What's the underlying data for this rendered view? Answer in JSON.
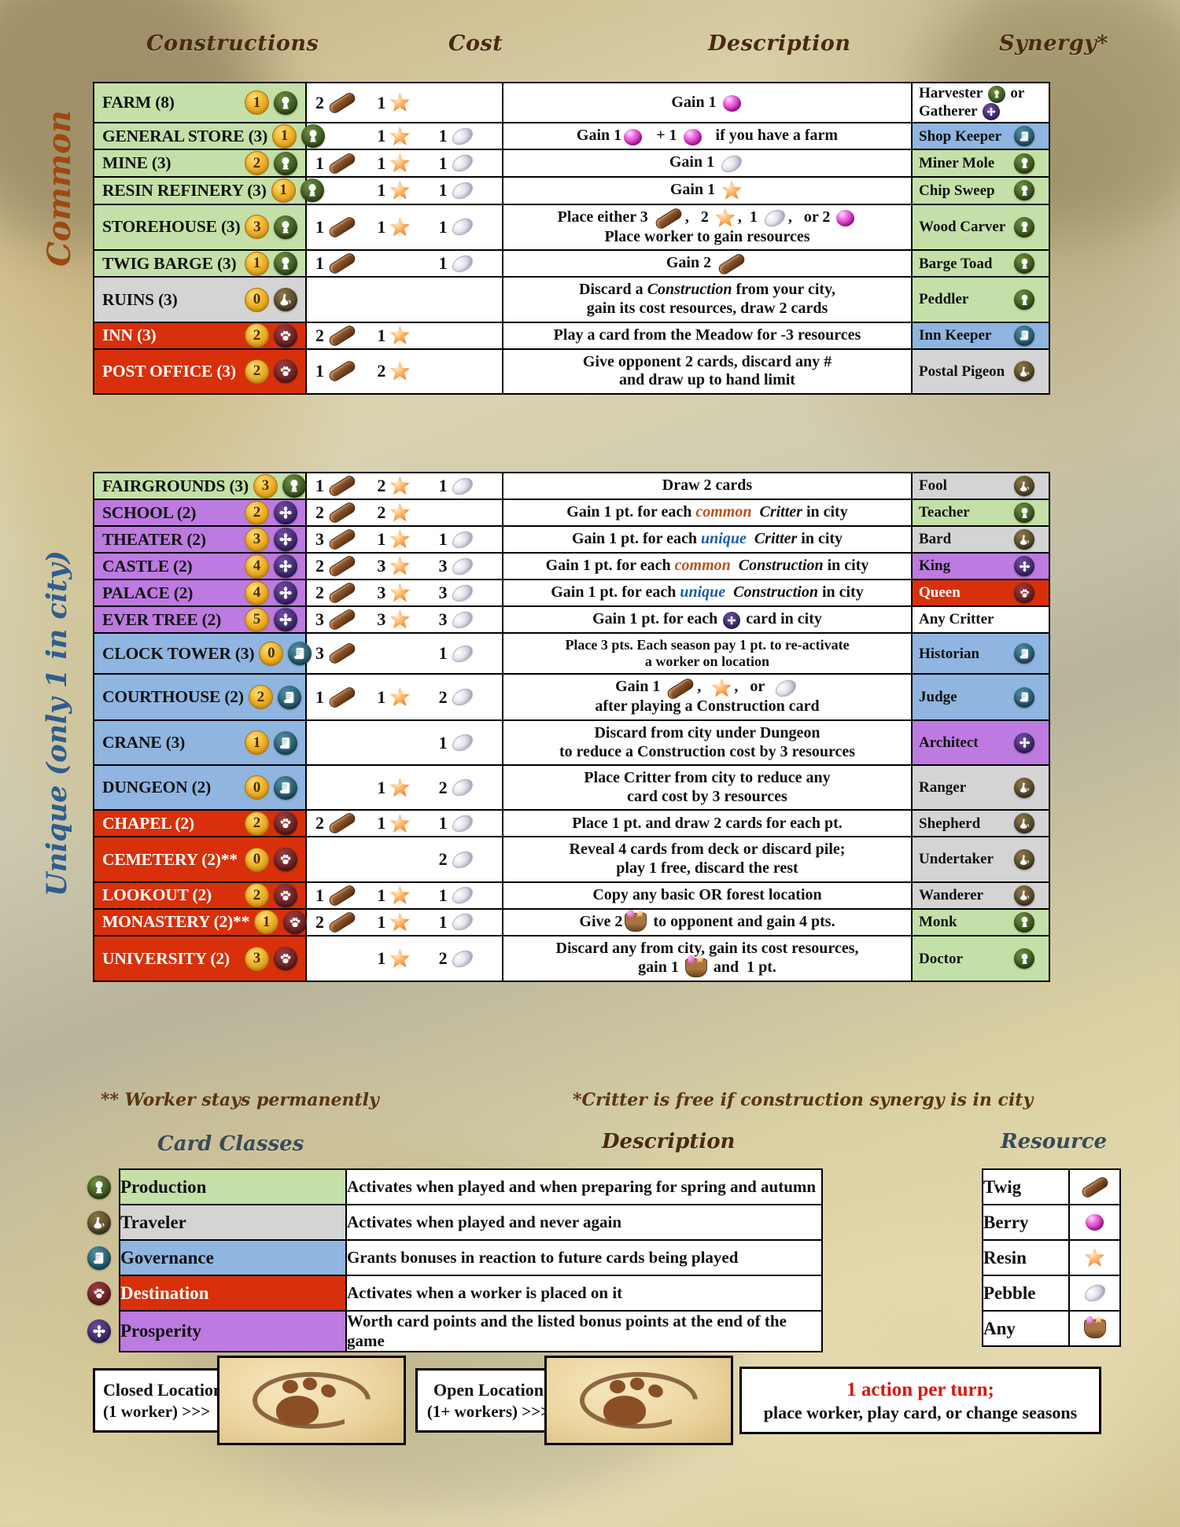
{
  "headers": {
    "constructions": "Constructions",
    "cost": "Cost",
    "description": "Description",
    "synergy": "Synergy*"
  },
  "side_labels": {
    "common": "Common",
    "unique": "Unique (only 1 in city)"
  },
  "footnotes": {
    "worker": "** Worker stays permanently",
    "critter": "*Critter is free if construction synergy is in city"
  },
  "common_rows": [
    {
      "name": "FARM (8)",
      "points": "1",
      "class": "production",
      "row_color": "green",
      "cost": [
        {
          "n": "2",
          "res": "twig"
        },
        {
          "n": "1",
          "res": "resin"
        },
        {
          "n": "",
          "res": ""
        }
      ],
      "desc_html": "Gain 1 <span class='inline-res'><span class='res res-berry'></span></span>",
      "synergy": "Harvester <span class='syn-inline-badge b-production'><svg viewBox='0 0 24 24'><path d='M12 3c-3 0-5 2.2-5 5 0 2.6 1.8 4.2 3.4 5.1-.9.6-1.6 1.4-1.6 2.4 0 1 .6 1.6 1.4 2.2H8v2h8v-2h-2.2c.8-.6 1.4-1.2 1.4-2.2 0-1-.7-1.8-1.6-2.4C15.2 12.2 17 10.6 17 8c0-2.8-2-5-5-5z' fill='#ffffff'/></svg></span> or<br>Gatherer <span class='syn-inline-badge b-prosperity'><svg viewBox='0 0 24 24'><g fill='#ffffff'><circle cx='12' cy='12' r='2.6'/><ellipse cx='12' cy='6.3' rx='2.6' ry='3.4'/><ellipse cx='12' cy='17.7' rx='2.6' ry='3.4'/><ellipse cx='6.3' cy='12' rx='3.4' ry='2.6'/><ellipse cx='17.7' cy='12' rx='3.4' ry='2.6'/></g></svg></span>",
      "syn_color": "white",
      "syn_badge": "none",
      "syn_light": false
    },
    {
      "name": "GENERAL STORE (3)",
      "points": "1",
      "class": "production",
      "row_color": "green",
      "cost": [
        {
          "n": "",
          "res": ""
        },
        {
          "n": "1",
          "res": "resin"
        },
        {
          "n": "1",
          "res": "pebble"
        }
      ],
      "desc_html": "Gain 1<span class='inline-res'><span class='res res-berry'></span></span> &nbsp;&nbsp;+ 1 <span class='inline-res'><span class='res res-berry'></span></span> &nbsp;&nbsp;if you have a farm",
      "synergy": "Shop Keeper",
      "syn_color": "blue",
      "syn_badge": "governance",
      "syn_light": false
    },
    {
      "name": "MINE (3)",
      "points": "2",
      "class": "production",
      "row_color": "green",
      "cost": [
        {
          "n": "1",
          "res": "twig"
        },
        {
          "n": "1",
          "res": "resin"
        },
        {
          "n": "1",
          "res": "pebble"
        }
      ],
      "desc_html": "Gain 1 <span class='inline-res'><span class='res res-pebble'></span></span>",
      "synergy": "Miner Mole",
      "syn_color": "green",
      "syn_badge": "production",
      "syn_light": false
    },
    {
      "name": "RESIN REFINERY (3)",
      "points": "1",
      "class": "production",
      "row_color": "green",
      "cost": [
        {
          "n": "",
          "res": ""
        },
        {
          "n": "1",
          "res": "resin"
        },
        {
          "n": "1",
          "res": "pebble"
        }
      ],
      "desc_html": "Gain 1 <span class='inline-res'><span class='res res-resin'></span></span>",
      "synergy": "Chip Sweep",
      "syn_color": "green",
      "syn_badge": "production",
      "syn_light": false
    },
    {
      "name": "STOREHOUSE (3)",
      "points": "3",
      "class": "production",
      "row_color": "green",
      "cost": [
        {
          "n": "1",
          "res": "twig"
        },
        {
          "n": "1",
          "res": "resin"
        },
        {
          "n": "1",
          "res": "pebble"
        }
      ],
      "desc_html": "Place either 3 <span class='inline-res'><span class='res res-twig'></span></span>, &nbsp; 2 <span class='inline-res'><span class='res res-resin'></span></span>, &nbsp;1 <span class='inline-res'><span class='res res-pebble'></span></span>, &nbsp; or 2 <span class='inline-res'><span class='res res-berry'></span></span><br>Place worker to gain resources",
      "synergy": "Wood Carver",
      "syn_color": "green",
      "syn_badge": "production",
      "syn_light": false
    },
    {
      "name": "TWIG BARGE (3)",
      "points": "1",
      "class": "production",
      "row_color": "green",
      "cost": [
        {
          "n": "1",
          "res": "twig"
        },
        {
          "n": "",
          "res": ""
        },
        {
          "n": "1",
          "res": "pebble"
        }
      ],
      "desc_html": "Gain 2 <span class='inline-res'><span class='res res-twig'></span></span>",
      "synergy": "Barge Toad",
      "syn_color": "green",
      "syn_badge": "production",
      "syn_light": false
    },
    {
      "name": "RUINS (3)",
      "points": "0",
      "class": "traveler",
      "row_color": "gray",
      "cost": [
        {
          "n": "",
          "res": ""
        },
        {
          "n": "",
          "res": ""
        },
        {
          "n": "",
          "res": ""
        }
      ],
      "desc_html": "Discard a <span class='em'>Construction</span> from your city,<br>gain its cost resources, draw 2 cards",
      "synergy": "Peddler",
      "syn_color": "green",
      "syn_badge": "production",
      "syn_light": false
    },
    {
      "name": "INN (3)",
      "points": "2",
      "class": "destination",
      "row_color": "red",
      "cost": [
        {
          "n": "2",
          "res": "twig"
        },
        {
          "n": "1",
          "res": "resin"
        },
        {
          "n": "",
          "res": ""
        }
      ],
      "desc_html": "Play a card from the Meadow for -3 resources",
      "synergy": "Inn Keeper",
      "syn_color": "blue",
      "syn_badge": "governance",
      "syn_light": false,
      "name_light": true
    },
    {
      "name": "POST OFFICE (3)",
      "points": "2",
      "class": "destination",
      "row_color": "red",
      "cost": [
        {
          "n": "1",
          "res": "twig"
        },
        {
          "n": "2",
          "res": "resin"
        },
        {
          "n": "",
          "res": ""
        }
      ],
      "desc_html": "Give opponent 2 cards, discard any #<br>and draw up to hand limit",
      "synergy": "Postal Pigeon",
      "syn_color": "gray",
      "syn_badge": "traveler",
      "syn_light": false,
      "name_light": true
    }
  ],
  "unique_rows": [
    {
      "name": "FAIRGROUNDS (3)",
      "points": "3",
      "class": "production",
      "row_color": "green",
      "cost": [
        {
          "n": "1",
          "res": "twig"
        },
        {
          "n": "2",
          "res": "resin"
        },
        {
          "n": "1",
          "res": "pebble"
        }
      ],
      "desc_html": "Draw 2 cards",
      "synergy": "Fool",
      "syn_color": "gray",
      "syn_badge": "traveler",
      "syn_light": false
    },
    {
      "name": "SCHOOL (2)",
      "points": "2",
      "class": "prosperity",
      "row_color": "purple",
      "cost": [
        {
          "n": "2",
          "res": "twig"
        },
        {
          "n": "2",
          "res": "resin"
        },
        {
          "n": "",
          "res": ""
        }
      ],
      "desc_html": "Gain 1 pt. for each <span class='common-w'>common</span> &nbsp;<span class='em'>Critter</span> in city",
      "synergy": "Teacher",
      "syn_color": "green",
      "syn_badge": "production",
      "syn_light": false
    },
    {
      "name": "THEATER (2)",
      "points": "3",
      "class": "prosperity",
      "row_color": "purple",
      "cost": [
        {
          "n": "3",
          "res": "twig"
        },
        {
          "n": "1",
          "res": "resin"
        },
        {
          "n": "1",
          "res": "pebble"
        }
      ],
      "desc_html": "Gain 1 pt. for each <span class='unique-w'>unique</span> &nbsp;<span class='em'>Critter</span> in city",
      "synergy": "Bard",
      "syn_color": "gray",
      "syn_badge": "traveler",
      "syn_light": false
    },
    {
      "name": "CASTLE (2)",
      "points": "4",
      "class": "prosperity",
      "row_color": "purple",
      "cost": [
        {
          "n": "2",
          "res": "twig"
        },
        {
          "n": "3",
          "res": "resin"
        },
        {
          "n": "3",
          "res": "pebble"
        }
      ],
      "desc_html": "Gain 1 pt. for each <span class='common-w'>common</span> &nbsp;<span class='em'>Construction</span> in city",
      "synergy": "King",
      "syn_color": "purple",
      "syn_badge": "prosperity",
      "syn_light": false
    },
    {
      "name": "PALACE (2)",
      "points": "4",
      "class": "prosperity",
      "row_color": "purple",
      "cost": [
        {
          "n": "2",
          "res": "twig"
        },
        {
          "n": "3",
          "res": "resin"
        },
        {
          "n": "3",
          "res": "pebble"
        }
      ],
      "desc_html": "Gain 1 pt. for each <span class='unique-w'>unique</span> &nbsp;<span class='em'>Construction</span> in city",
      "synergy": "Queen",
      "syn_color": "red",
      "syn_badge": "destination",
      "syn_light": true
    },
    {
      "name": "EVER TREE (2)",
      "points": "5",
      "class": "prosperity",
      "row_color": "purple",
      "cost": [
        {
          "n": "3",
          "res": "twig"
        },
        {
          "n": "3",
          "res": "resin"
        },
        {
          "n": "3",
          "res": "pebble"
        }
      ],
      "desc_html": "Gain 1 pt. for each <span class='syn-inline-badge b-prosperity'><svg viewBox='0 0 24 24'><g fill='#ffffff'><circle cx='12' cy='12' r='2.6'/><ellipse cx='12' cy='6.3' rx='2.6' ry='3.4'/><ellipse cx='12' cy='17.7' rx='2.6' ry='3.4'/><ellipse cx='6.3' cy='12' rx='3.4' ry='2.6'/><ellipse cx='17.7' cy='12' rx='3.4' ry='2.6'/></g></svg></span> card in city",
      "synergy": "Any Critter",
      "syn_color": "white",
      "syn_badge": "none",
      "syn_light": false
    },
    {
      "name": "CLOCK TOWER (3)",
      "points": "0",
      "class": "governance",
      "row_color": "blue",
      "cost": [
        {
          "n": "3",
          "res": "twig"
        },
        {
          "n": "",
          "res": ""
        },
        {
          "n": "1",
          "res": "pebble"
        }
      ],
      "desc_html": "Place 3 pts. Each season pay 1 pt. to re-activate<br>a worker on location",
      "synergy": "Historian",
      "syn_color": "blue",
      "syn_badge": "governance",
      "syn_light": false,
      "small_desc": true
    },
    {
      "name": "COURTHOUSE (2)",
      "points": "2",
      "class": "governance",
      "row_color": "blue",
      "cost": [
        {
          "n": "1",
          "res": "twig"
        },
        {
          "n": "1",
          "res": "resin"
        },
        {
          "n": "2",
          "res": "pebble"
        }
      ],
      "desc_html": "Gain 1 <span class='inline-res'><span class='res res-twig'></span></span>, &nbsp;<span class='inline-res'><span class='res res-resin'></span></span>, &nbsp; or &nbsp;<span class='inline-res'><span class='res res-pebble'></span></span><br>after playing a Construction card",
      "synergy": "Judge",
      "syn_color": "blue",
      "syn_badge": "governance",
      "syn_light": false
    },
    {
      "name": "CRANE (3)",
      "points": "1",
      "class": "governance",
      "row_color": "blue",
      "cost": [
        {
          "n": "",
          "res": ""
        },
        {
          "n": "",
          "res": ""
        },
        {
          "n": "1",
          "res": "pebble"
        }
      ],
      "desc_html": "Discard from city under Dungeon<br>to reduce a Construction cost by 3 resources",
      "synergy": "Architect",
      "syn_color": "purple",
      "syn_badge": "prosperity",
      "syn_light": false
    },
    {
      "name": "DUNGEON (2)",
      "points": "0",
      "class": "governance",
      "row_color": "blue",
      "cost": [
        {
          "n": "",
          "res": ""
        },
        {
          "n": "1",
          "res": "resin"
        },
        {
          "n": "2",
          "res": "pebble"
        }
      ],
      "desc_html": "Place Critter from city to reduce any<br>card cost by 3 resources",
      "synergy": "Ranger",
      "syn_color": "gray",
      "syn_badge": "traveler",
      "syn_light": false
    },
    {
      "name": "CHAPEL (2)",
      "points": "2",
      "class": "destination",
      "row_color": "red",
      "cost": [
        {
          "n": "2",
          "res": "twig"
        },
        {
          "n": "1",
          "res": "resin"
        },
        {
          "n": "1",
          "res": "pebble"
        }
      ],
      "desc_html": "Place 1 pt. and draw 2 cards for each pt.",
      "synergy": "Shepherd",
      "syn_color": "gray",
      "syn_badge": "traveler",
      "syn_light": false,
      "name_light": true
    },
    {
      "name": "CEMETERY (2)**",
      "points": "0",
      "class": "destination",
      "row_color": "red",
      "cost": [
        {
          "n": "",
          "res": ""
        },
        {
          "n": "",
          "res": ""
        },
        {
          "n": "2",
          "res": "pebble"
        }
      ],
      "desc_html": "Reveal 4 cards from deck or discard pile;<br>play 1 free, discard the rest",
      "synergy": "Undertaker",
      "syn_color": "gray",
      "syn_badge": "traveler",
      "syn_light": false,
      "name_light": true
    },
    {
      "name": "LOOKOUT (2)",
      "points": "2",
      "class": "destination",
      "row_color": "red",
      "cost": [
        {
          "n": "1",
          "res": "twig"
        },
        {
          "n": "1",
          "res": "resin"
        },
        {
          "n": "1",
          "res": "pebble"
        }
      ],
      "desc_html": "Copy any basic OR forest location",
      "synergy": "Wanderer",
      "syn_color": "gray",
      "syn_badge": "traveler",
      "syn_light": false,
      "name_light": true
    },
    {
      "name": "MONASTERY (2)**",
      "points": "1",
      "class": "destination",
      "row_color": "red",
      "cost": [
        {
          "n": "2",
          "res": "twig"
        },
        {
          "n": "1",
          "res": "resin"
        },
        {
          "n": "1",
          "res": "pebble"
        }
      ],
      "desc_html": "Give 2<span class='inline-res'><span class='res res-any'></span></span> to opponent and gain 4 pts.",
      "synergy": "Monk",
      "syn_color": "green",
      "syn_badge": "production",
      "syn_light": false,
      "name_light": true
    },
    {
      "name": "UNIVERSITY (2)",
      "points": "3",
      "class": "destination",
      "row_color": "red",
      "cost": [
        {
          "n": "",
          "res": ""
        },
        {
          "n": "1",
          "res": "resin"
        },
        {
          "n": "2",
          "res": "pebble"
        }
      ],
      "desc_html": "Discard any from city, gain its cost resources,<br>gain 1 <span class='inline-res'><span class='res res-any'></span></span> and&nbsp; 1 pt.",
      "synergy": "Doctor",
      "syn_color": "green",
      "syn_badge": "production",
      "syn_light": false,
      "name_light": true
    }
  ],
  "legend": {
    "card_classes_title": "Card Classes",
    "description_title": "Description",
    "resource_title": "Resource",
    "classes": [
      {
        "name": "Production",
        "color": "green",
        "badge": "production",
        "desc": "Activates when played and when preparing for spring and autumn",
        "light": false
      },
      {
        "name": "Traveler",
        "color": "gray",
        "badge": "traveler",
        "desc": "Activates when played and never again",
        "light": false
      },
      {
        "name": "Governance",
        "color": "blue",
        "badge": "governance",
        "desc": "Grants bonuses in reaction to future cards being played",
        "light": false
      },
      {
        "name": "Destination",
        "color": "red",
        "badge": "destination",
        "desc": "Activates when a worker is placed on it",
        "light": true
      },
      {
        "name": "Prosperity",
        "color": "purple",
        "badge": "prosperity",
        "desc": "Worth card points and the listed bonus points at the end of the game",
        "light": false
      }
    ],
    "resources": [
      {
        "name": "Twig",
        "icon": "twig"
      },
      {
        "name": "Berry",
        "icon": "berry"
      },
      {
        "name": "Resin",
        "icon": "resin"
      },
      {
        "name": "Pebble",
        "icon": "pebble"
      },
      {
        "name": "Any",
        "icon": "any"
      }
    ]
  },
  "locations": {
    "closed_line1": "Closed Location",
    "closed_line2": "(1 worker)   >>>",
    "open_line1": "Open Location",
    "open_line2": "(1+ workers) >>>",
    "action_line1": "1 action per turn;",
    "action_line2": "place worker, play card, or change seasons"
  }
}
